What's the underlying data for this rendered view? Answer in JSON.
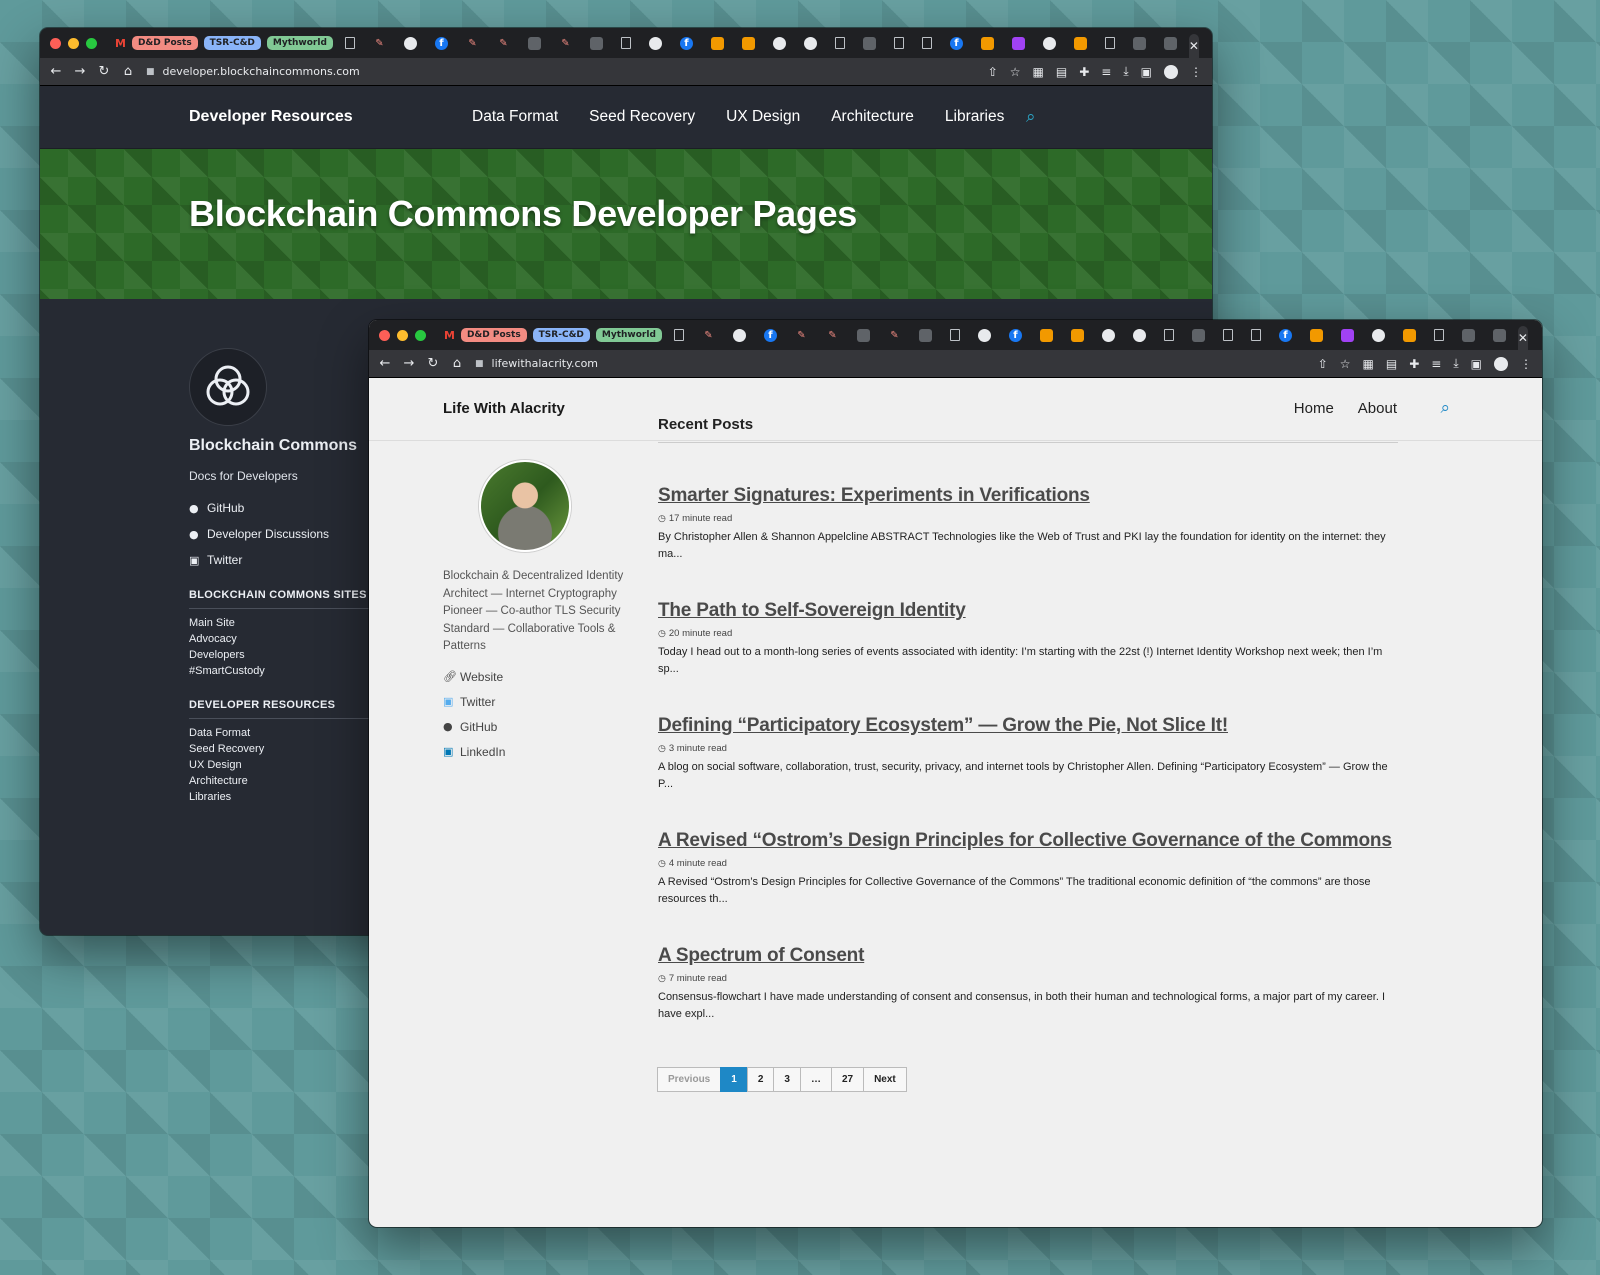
{
  "tab_groups": {
    "group1": "D&D Posts",
    "group2": "TSR-C&D",
    "group3": "Mythworld"
  },
  "back_window": {
    "url": "developer.blockchaincommons.com",
    "nav": {
      "site_title": "Developer Resources",
      "links": [
        "Data Format",
        "Seed Recovery",
        "UX Design",
        "Architecture",
        "Libraries"
      ]
    },
    "hero_title": "Blockchain Commons Developer Pages",
    "sidebar": {
      "org_name": "Blockchain Commons",
      "tagline": "Docs for Developers",
      "social": [
        "GitHub",
        "Developer Discussions",
        "Twitter"
      ],
      "sites_heading": "BLOCKCHAIN COMMONS SITES",
      "sites": [
        "Main Site",
        "Advocacy",
        "Developers",
        "#SmartCustody"
      ],
      "resources_heading": "DEVELOPER RESOURCES",
      "resources": [
        "Data Format",
        "Seed Recovery",
        "UX Design",
        "Architecture",
        "Libraries"
      ]
    }
  },
  "front_window": {
    "url": "lifewithalacrity.com",
    "nav": {
      "site_title": "Life With Alacrity",
      "home": "Home",
      "about": "About"
    },
    "sidebar": {
      "bio": "Blockchain & Decentralized Identity Architect — Internet Cryptography Pioneer — Co-author TLS Security Standard — Collaborative Tools & Patterns",
      "links": [
        "Website",
        "Twitter",
        "GitHub",
        "LinkedIn"
      ]
    },
    "recent_posts_heading": "Recent Posts",
    "posts": [
      {
        "title": "Smarter Signatures: Experiments in Verifications",
        "read_time": "17 minute read",
        "excerpt": "By Christopher Allen & Shannon Appelcline ABSTRACT Technologies like the Web of Trust and PKI lay the foundation for identity on the internet: they ma..."
      },
      {
        "title": "The Path to Self-Sovereign Identity",
        "read_time": "20 minute read",
        "excerpt": "Today I head out to a month-long series of events associated with identity: I’m starting with the 22st (!) Internet Identity Workshop next week; then I’m sp..."
      },
      {
        "title": "Defining “Participatory Ecosystem” — Grow the Pie, Not Slice It!",
        "read_time": "3 minute read",
        "excerpt": "A blog on social software, collaboration, trust, security, privacy, and internet tools by Christopher Allen. Defining “Participatory Ecosystem” — Grow the P..."
      },
      {
        "title": "A Revised “Ostrom’s Design Principles for Collective Governance of the Commons",
        "read_time": "4 minute read",
        "excerpt": "A Revised “Ostrom’s Design Principles for Collective Governance of the Commons” The traditional economic definition of “the commons” are those resources th..."
      },
      {
        "title": "A Spectrum of Consent",
        "read_time": "7 minute read",
        "excerpt": "Consensus-flowchart I have made understanding of consent and consensus, in both their human and technological forms, a major part of my career. I have expl..."
      }
    ],
    "pagination": {
      "previous": "Previous",
      "pages": [
        "1",
        "2",
        "3",
        "…",
        "27"
      ],
      "current": "1",
      "next": "Next"
    }
  },
  "colors": {
    "accent_blue": "#1e88c6",
    "dev_accent": "#2ba7c8",
    "hero_green": "#2d6a28",
    "background_teal": "#5f9a9b"
  }
}
